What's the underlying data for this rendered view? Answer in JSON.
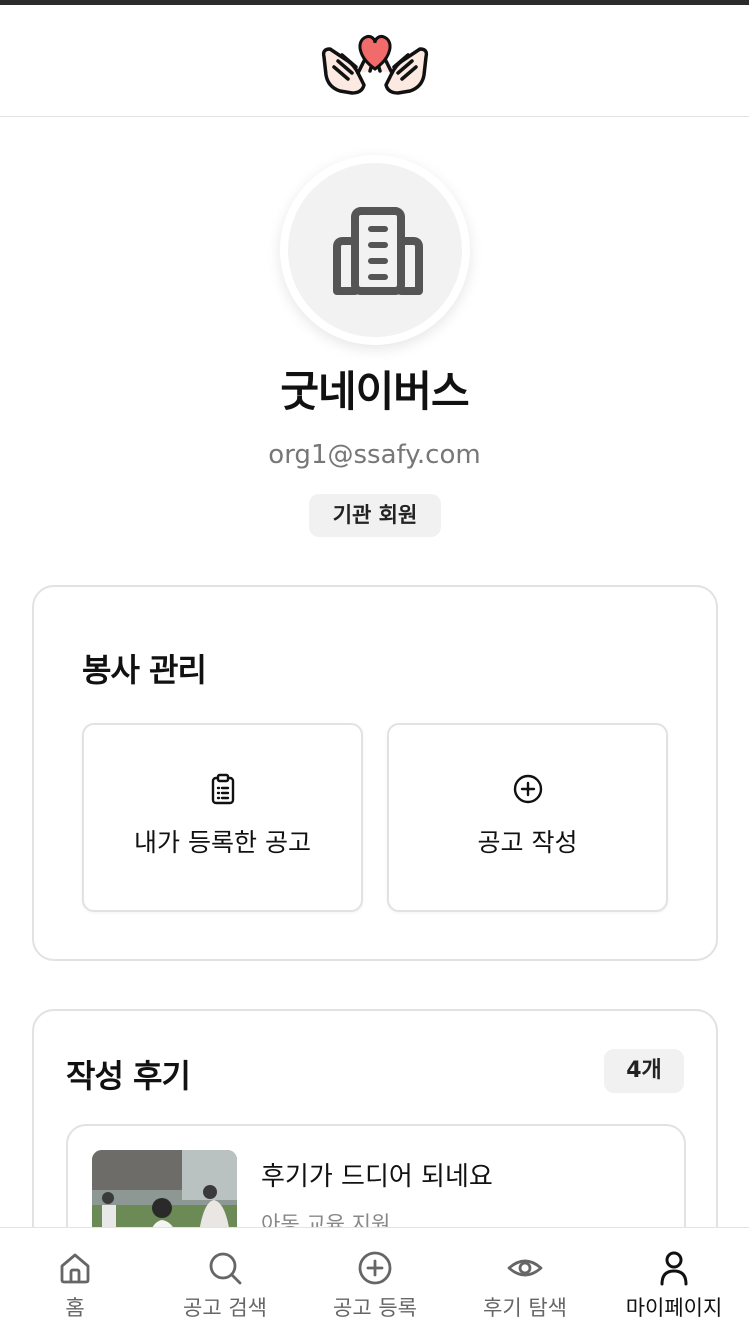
{
  "header": {
    "logo_icon": "heart-hands-logo-icon"
  },
  "profile": {
    "avatar_icon": "building-icon",
    "name": "굿네이버스",
    "email": "org1@ssafy.com",
    "member_type": "기관 회원"
  },
  "manage": {
    "title": "봉사 관리",
    "tiles": [
      {
        "label": "내가 등록한 공고",
        "icon": "clipboard-list-icon"
      },
      {
        "label": "공고 작성",
        "icon": "plus-circle-icon"
      }
    ]
  },
  "reviews": {
    "title": "작성 후기",
    "count": "4개",
    "items": [
      {
        "title": "후기가 드디어 되네요",
        "subtitle": "아동 교육 지원",
        "thumbnail": "volunteer-photo"
      }
    ]
  },
  "nav": {
    "items": [
      {
        "label": "홈",
        "icon": "home-icon"
      },
      {
        "label": "공고 검색",
        "icon": "search-icon"
      },
      {
        "label": "공고 등록",
        "icon": "plus-circle-icon"
      },
      {
        "label": "후기 탐색",
        "icon": "eye-icon"
      },
      {
        "label": "마이페이지",
        "icon": "user-icon"
      }
    ],
    "active_index": 4
  },
  "colors": {
    "accent_heart": "#f26b6b",
    "text_primary": "#111111",
    "text_secondary": "#777777",
    "badge_bg": "#f1f1f1",
    "border": "#e2e2e2"
  }
}
